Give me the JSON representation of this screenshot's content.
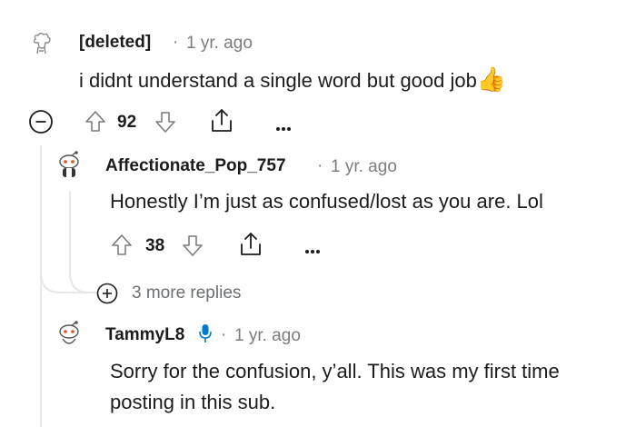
{
  "comments": [
    {
      "username": "[deleted]",
      "time": "1 yr. ago",
      "text": "i didnt understand a single word but good job",
      "emoji": "👍",
      "votes": "92"
    },
    {
      "username": "Affectionate_Pop_757",
      "time": "1 yr. ago",
      "text": "Honestly I’m just as confused/lost as you are. Lol",
      "votes": "38"
    },
    {
      "username": "TammyL8",
      "time": "1 yr. ago",
      "text": "Sorry for the confusion, y’all. This was my first time posting in this sub."
    }
  ],
  "more_replies_label": "3 more replies",
  "colors": {
    "thread_line": "#e6e8ea",
    "icon_gray": "#7c7c7c",
    "mic_blue": "#0079d3"
  },
  "icons": [
    "deleted-avatar-icon",
    "collapse-icon",
    "upvote-icon",
    "downvote-icon",
    "share-icon",
    "more-options-icon",
    "expand-icon",
    "microphone-icon"
  ]
}
